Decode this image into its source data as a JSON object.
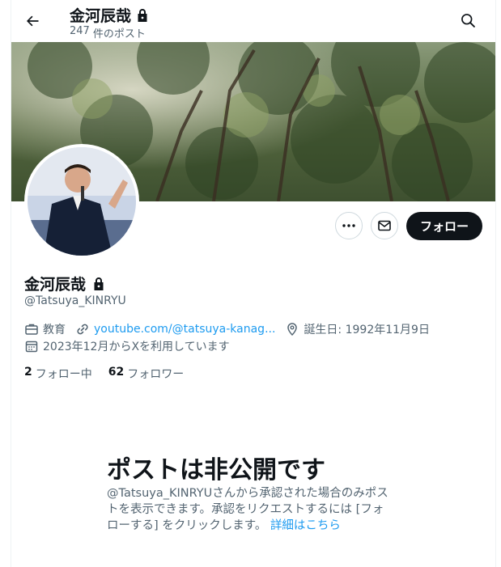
{
  "header": {
    "name": "金河辰哉",
    "post_count": "247",
    "post_suffix": "件のポスト"
  },
  "profile": {
    "display_name": "金河辰哉",
    "handle": "@Tatsuya_KINRYU",
    "category": "教育",
    "website": "youtube.com/@tatsuya-kanag...",
    "birthday": "誕生日: 1992年11月9日",
    "joined": "2023年12月からXを利用しています"
  },
  "actions": {
    "follow_label": "フォロー"
  },
  "counts": {
    "following_num": "2",
    "following_label": "フォロー中",
    "followers_num": "62",
    "followers_label": "フォロワー"
  },
  "private_notice": {
    "title": "ポストは非公開です",
    "body_line1": "@Tatsuya_KINRYUさんから承認された場合のみポス",
    "body_line2": "トを表示できます。承認をリクエストするには [フォ",
    "body_line3": "ローする] をクリックします。",
    "link": "詳細はこちら"
  },
  "colors": {
    "accent": "#1d9bf0",
    "text": "#0f1419",
    "secondary": "#536471"
  },
  "icons": [
    "back-arrow-icon",
    "lock-icon",
    "search-icon",
    "more-icon",
    "mail-icon",
    "briefcase-icon",
    "link-icon",
    "location-icon",
    "calendar-icon"
  ]
}
